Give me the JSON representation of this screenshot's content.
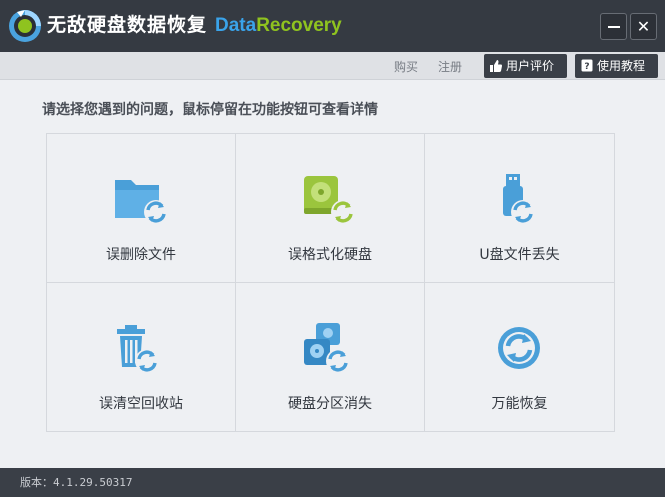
{
  "window": {
    "title": "无敌硬盘数据恢复",
    "brand_part1": "Data",
    "brand_part2": "Recovery",
    "minimize_icon": "minimize-icon",
    "close_glyph": "✕"
  },
  "toolbar": {
    "buy_label": "购买",
    "register_label": "注册",
    "rate_label": "用户评价",
    "tutorial_label": "使用教程"
  },
  "main": {
    "prompt": "请选择您遇到的问题，鼠标停留在功能按钮可查看详情",
    "options": [
      {
        "label": "误删除文件",
        "icon": "folder-restore-icon"
      },
      {
        "label": "误格式化硬盘",
        "icon": "disk-restore-icon"
      },
      {
        "label": "U盘文件丢失",
        "icon": "usb-restore-icon"
      },
      {
        "label": "误清空回收站",
        "icon": "recycle-bin-restore-icon"
      },
      {
        "label": "硬盘分区消失",
        "icon": "partition-restore-icon"
      },
      {
        "label": "万能恢复",
        "icon": "universal-restore-icon"
      }
    ]
  },
  "status": {
    "version": "版本：4.1.29.50317"
  },
  "colors": {
    "titlebar": "#353a42",
    "brand_blue": "#3aa3ea",
    "brand_green": "#8fc31f",
    "icon_blue": "#4a9fd8",
    "icon_green": "#9bc53d"
  }
}
